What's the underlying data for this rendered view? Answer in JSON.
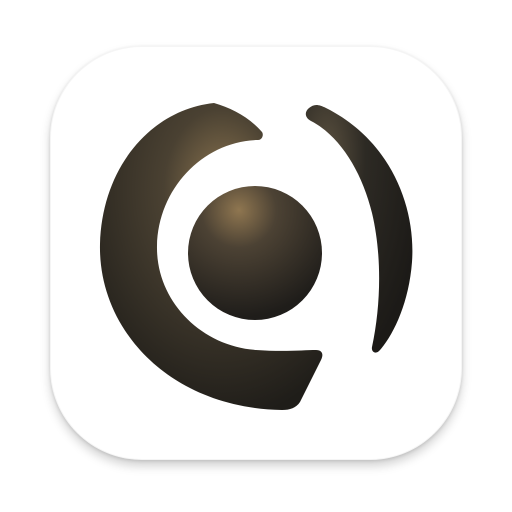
{
  "app_icon": {
    "icon": "abstract-c-ring-icon",
    "colors": {
      "background": "#ffffff",
      "glyph_dark": "#23211c",
      "glyph_mid": "#3a352b",
      "glyph_highlight": "#8c7550"
    }
  }
}
